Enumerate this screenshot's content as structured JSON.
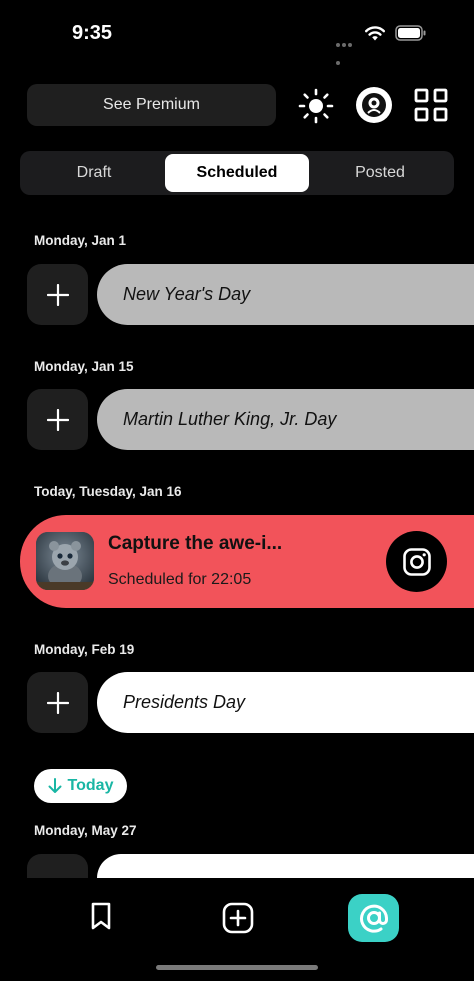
{
  "status_bar": {
    "time": "9:35"
  },
  "header": {
    "premium_label": "See Premium"
  },
  "tabs": [
    {
      "label": "Draft",
      "selected": false
    },
    {
      "label": "Scheduled",
      "selected": true
    },
    {
      "label": "Posted",
      "selected": false
    }
  ],
  "days": [
    {
      "header": "Monday, Jan 1",
      "holiday": "New Year's Day",
      "style": "gray"
    },
    {
      "header": "Monday, Jan 15",
      "holiday": "Martin Luther King, Jr. Day",
      "style": "gray"
    },
    {
      "header": "Today, Tuesday, Jan 16"
    },
    {
      "header": "Monday, Feb 19",
      "holiday": "Presidents Day",
      "style": "white"
    },
    {
      "header": "Monday, May 27"
    }
  ],
  "scheduled_post": {
    "title": "Capture the awe-i...",
    "subtitle": "Scheduled for 22:05",
    "platform_icon": "instagram-icon",
    "accent_color": "#f2535a"
  },
  "today_chip": {
    "label": "Today",
    "color": "#19b6a4"
  },
  "bottom_nav": {
    "items": [
      {
        "icon": "bookmark-icon"
      },
      {
        "icon": "add-square-icon"
      },
      {
        "icon": "at-icon",
        "active": true,
        "color": "#3bd1c6"
      }
    ]
  }
}
